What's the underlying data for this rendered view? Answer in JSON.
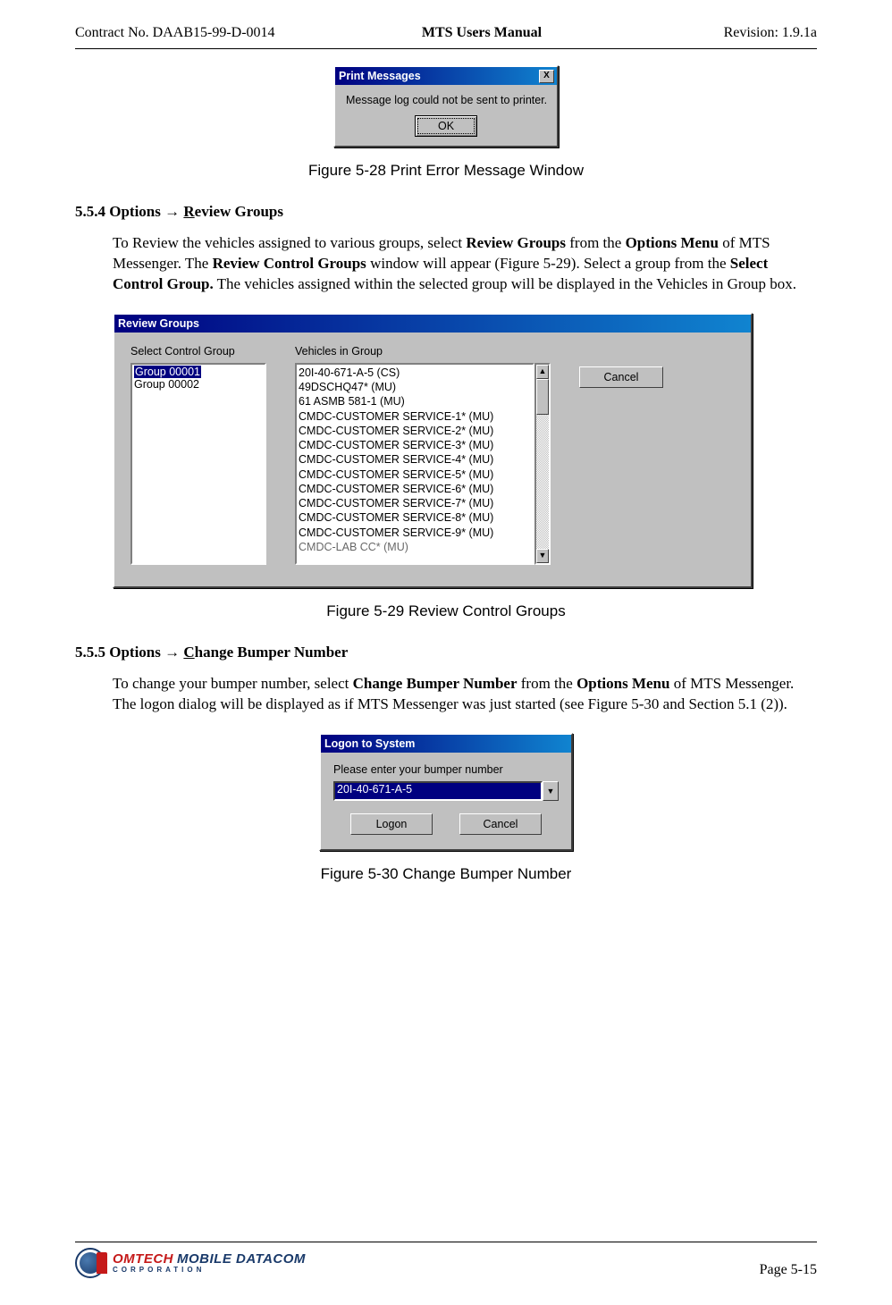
{
  "header": {
    "left": "Contract No. DAAB15-99-D-0014",
    "center": "MTS Users Manual",
    "right": "Revision:  1.9.1a"
  },
  "printDialog": {
    "title": "Print Messages",
    "close": "X",
    "message": "Message log could not be sent to printer.",
    "ok": "OK"
  },
  "fig528": "Figure 5-28   Print Error Message Window",
  "sec554": {
    "num": "5.5.4  Options ",
    "arrow": "→ ",
    "u": "R",
    "rest": "eview Groups"
  },
  "para554": {
    "t1": "To Review the vehicles assigned to various groups, select ",
    "b1": "Review Groups",
    "t2": " from the ",
    "b2": "Options Menu",
    "t3": " of MTS Messenger.  The ",
    "b3": "Review Control Groups",
    "t4": " window will appear (Figure 5-29).  Select a group from the ",
    "b4": "Select Control Group.",
    "t5": " The vehicles assigned within the selected group will be displayed in the Vehicles in Group box."
  },
  "reviewDialog": {
    "title": "Review Groups",
    "lblGroups": "Select Control Group",
    "lblVehicles": "Vehicles in Group",
    "groups": [
      "Group 00001",
      "Group 00002"
    ],
    "vehicles": [
      "20I-40-671-A-5 (CS)",
      "49DSCHQ47* (MU)",
      "61 ASMB 581-1 (MU)",
      "CMDC-CUSTOMER SERVICE-1* (MU)",
      "CMDC-CUSTOMER SERVICE-2* (MU)",
      "CMDC-CUSTOMER SERVICE-3* (MU)",
      "CMDC-CUSTOMER SERVICE-4* (MU)",
      "CMDC-CUSTOMER SERVICE-5* (MU)",
      "CMDC-CUSTOMER SERVICE-6* (MU)",
      "CMDC-CUSTOMER SERVICE-7* (MU)",
      "CMDC-CUSTOMER SERVICE-8* (MU)",
      "CMDC-CUSTOMER SERVICE-9* (MU)",
      "CMDC-LAB CC* (MU)"
    ],
    "cancel": "Cancel"
  },
  "fig529": "Figure 5-29   Review Control Groups",
  "sec555": {
    "num": "5.5.5  Options ",
    "arrow": "→ ",
    "u": "C",
    "rest": "hange Bumper Number"
  },
  "para555": {
    "t1": "To change your bumper number, select ",
    "b1": "Change Bumper Number",
    "t2": " from the ",
    "b2": "Options Menu",
    "t3": " of MTS Messenger.  The logon dialog will be displayed as if MTS Messenger was just started (see Figure 5-30 and Section 5.1 (2))."
  },
  "logonDialog": {
    "title": "Logon to System",
    "prompt": "Please enter your bumper number",
    "value": "20I-40-671-A-5",
    "logon": "Logon",
    "cancel": "Cancel"
  },
  "fig530": "Figure 5-30   Change Bumper Number",
  "footer": {
    "logo1": "OMTECH",
    "logo2": "MOBILE DATACOM",
    "logo3": "CORPORATION",
    "page": "Page 5-15"
  }
}
